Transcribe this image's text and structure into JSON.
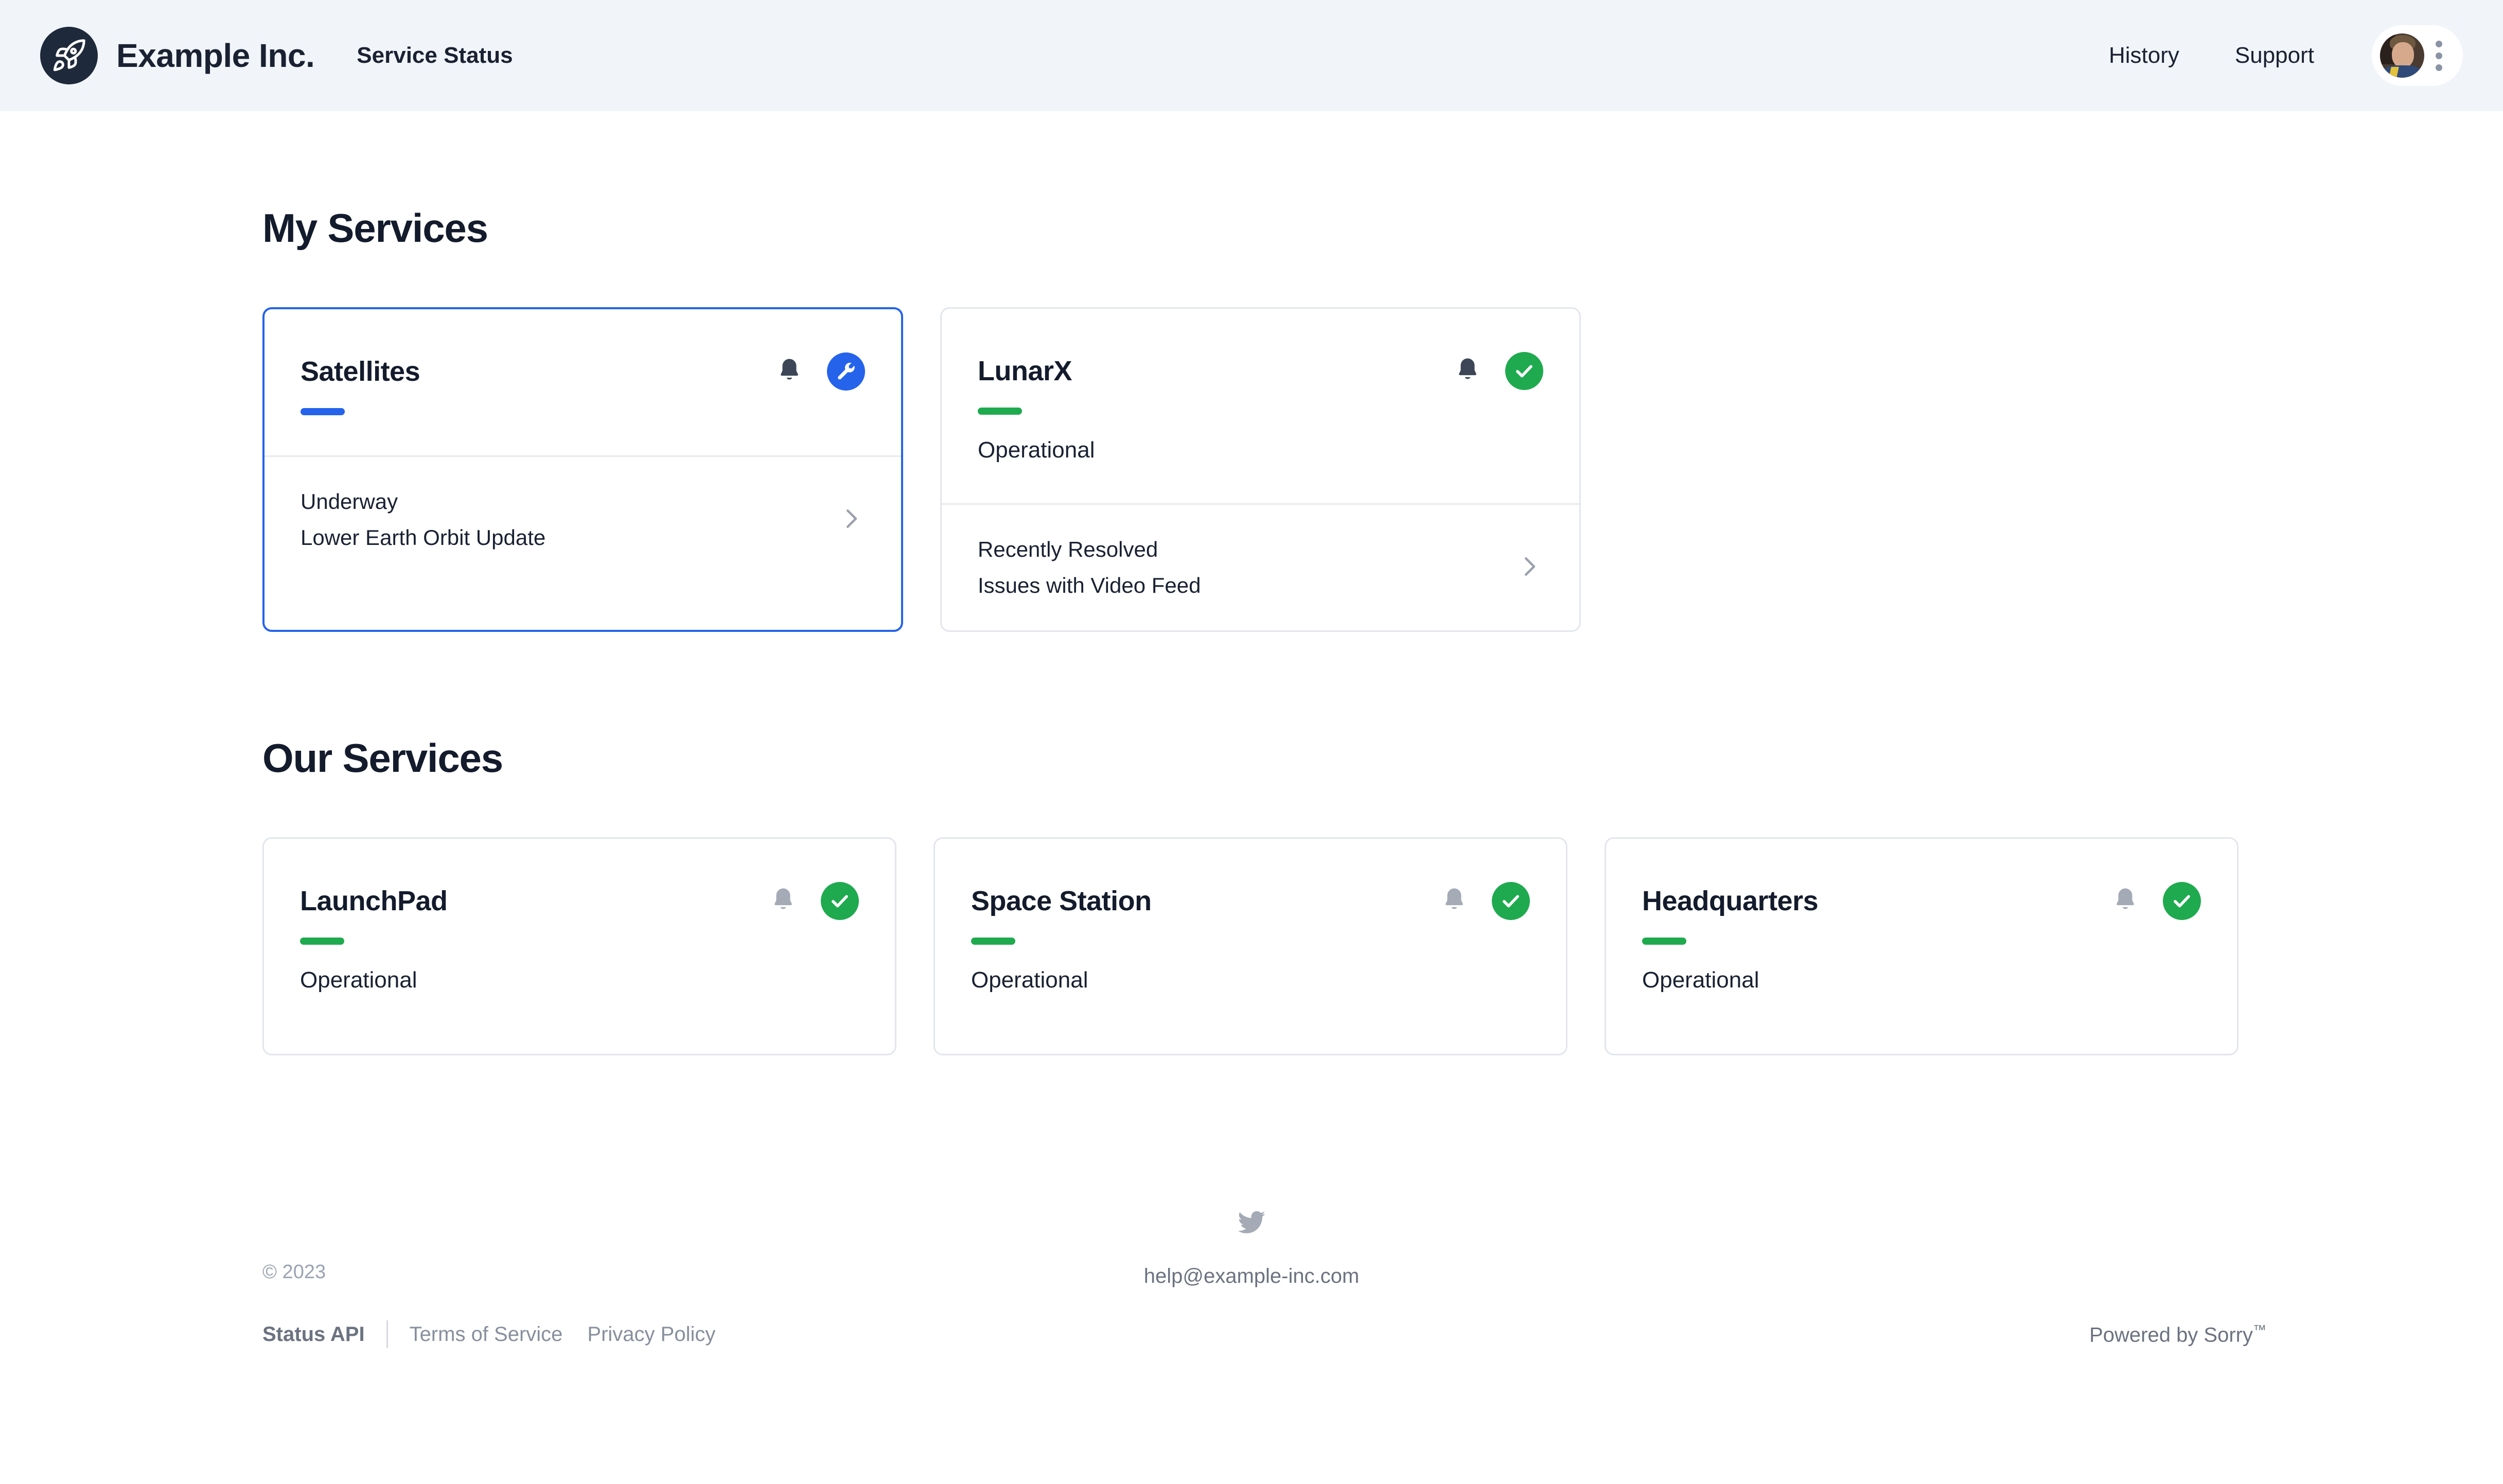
{
  "header": {
    "logo_icon": "rocket-icon",
    "brand_name": "Example Inc.",
    "page_subtitle": "Service Status",
    "nav": [
      {
        "label": "History"
      },
      {
        "label": "Support"
      }
    ],
    "account": {
      "avatar_icon": "user-avatar",
      "menu_icon": "vertical-dots-icon"
    },
    "background_color": "#f1f4f9"
  },
  "my_services": {
    "title": "My Services",
    "cards": [
      {
        "name": "Satellites",
        "status_label": "",
        "status_color": "#2563eb",
        "bell_icon": "bell-icon",
        "bell_state": "active",
        "badge_icon": "wrench-icon",
        "badge_color": "#2563eb",
        "selected": true,
        "footer": {
          "label": "Underway",
          "sub": "Lower Earth Orbit Update",
          "chevron_icon": "chevron-right-icon"
        }
      },
      {
        "name": "LunarX",
        "status_label": "Operational",
        "status_color": "#1faa4f",
        "bell_icon": "bell-icon",
        "bell_state": "active",
        "badge_icon": "check-circle-icon",
        "badge_color": "#1faa4f",
        "selected": false,
        "footer": {
          "label": "Recently Resolved",
          "sub": "Issues with Video Feed",
          "chevron_icon": "chevron-right-icon"
        }
      }
    ]
  },
  "our_services": {
    "title": "Our Services",
    "cards": [
      {
        "name": "LaunchPad",
        "status_label": "Operational",
        "status_color": "#1faa4f",
        "bell_icon": "bell-icon",
        "bell_state": "muted",
        "badge_icon": "check-circle-icon",
        "badge_color": "#1faa4f"
      },
      {
        "name": "Space Station",
        "status_label": "Operational",
        "status_color": "#1faa4f",
        "bell_icon": "bell-icon",
        "bell_state": "muted",
        "badge_icon": "check-circle-icon",
        "badge_color": "#1faa4f"
      },
      {
        "name": "Headquarters",
        "status_label": "Operational",
        "status_color": "#1faa4f",
        "bell_icon": "bell-icon",
        "bell_state": "muted",
        "badge_icon": "check-circle-icon",
        "badge_color": "#1faa4f"
      }
    ]
  },
  "footer": {
    "copyright": "© 2023",
    "status_api": "Status API",
    "terms": "Terms of Service",
    "privacy": "Privacy Policy",
    "twitter_icon": "twitter-icon",
    "email": "help@example-inc.com",
    "powered_by": "Powered by Sorry",
    "powered_by_tm": "™"
  }
}
